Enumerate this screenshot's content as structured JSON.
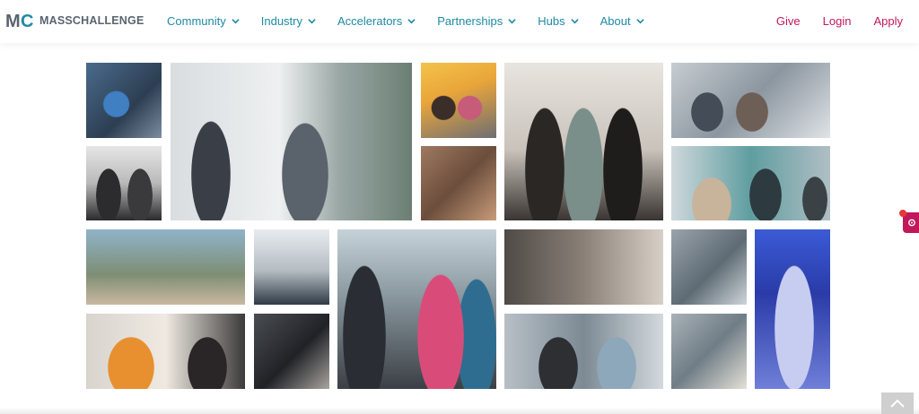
{
  "brand": {
    "logo_mark": "MC",
    "logo_text": "MASSCHALLENGE"
  },
  "nav": {
    "items": [
      {
        "label": "Community"
      },
      {
        "label": "Industry"
      },
      {
        "label": "Accelerators"
      },
      {
        "label": "Partnerships"
      },
      {
        "label": "Hubs"
      },
      {
        "label": "About"
      }
    ]
  },
  "header_links": {
    "give": "Give",
    "login": "Login",
    "apply": "Apply"
  },
  "colors": {
    "nav": "#1f8aa3",
    "accent": "#c2185b",
    "logo_gray": "#5a6470"
  },
  "gallery": {
    "photos": [
      {
        "name": "photo-team-laptops"
      },
      {
        "name": "photo-whiteboard-session"
      },
      {
        "name": "photo-selfie-duo"
      },
      {
        "name": "photo-three-women-badges"
      },
      {
        "name": "photo-workshop-room"
      },
      {
        "name": "photo-panel-speakers"
      },
      {
        "name": "photo-audience-seated"
      },
      {
        "name": "photo-office-meeting"
      },
      {
        "name": "photo-lounge-group"
      },
      {
        "name": "photo-badge-lineup"
      },
      {
        "name": "photo-networking-crowd"
      },
      {
        "name": "photo-mentor-conversation"
      },
      {
        "name": "photo-office-desks"
      },
      {
        "name": "photo-stage-speaker"
      },
      {
        "name": "photo-two-women-talking"
      },
      {
        "name": "photo-small-group-chat"
      },
      {
        "name": "photo-hallway-talk"
      },
      {
        "name": "photo-coffee-chat"
      }
    ]
  },
  "icons": {
    "scroll_top": "chevron-up-icon",
    "side_tab": "gear-icon"
  }
}
